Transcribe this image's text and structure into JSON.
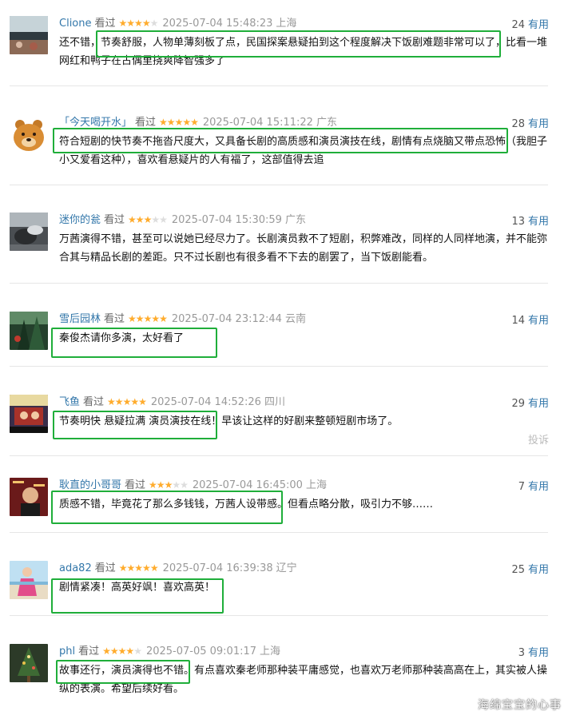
{
  "watched_label": "看过",
  "useful_label": "有用",
  "report_label": "投诉",
  "watermark": "海绵宝宝的心事",
  "comments": [
    {
      "user": "Clione",
      "stars": 4,
      "time": "2025-07-04 15:48:23",
      "location": "上海",
      "useful": "24",
      "text": "还不错，节奏舒服，人物单薄刻板了点，民国探案悬疑拍到这个程度解决下饭剧难题非常可以了，比看一堆网红和鸭子在古偶里挠爽降智强多了",
      "highlight": "节奏舒服，人物单薄刻板了点，民国探案悬疑拍到这个程度解决下饭剧难题非常可以了，"
    },
    {
      "user": "「今天喝开水」",
      "stars": 5,
      "time": "2025-07-04 15:11:22",
      "location": "广东",
      "useful": "28",
      "text": "符合短剧的快节奏不拖沓尺度大，又具备长剧的高质感和演员演技在线，剧情有点烧脑又带点恐怖（我胆子小又爱看这种），喜欢看悬疑片的人有福了，这部值得去追",
      "highlight": "符合短剧的快节奏不拖沓尺度大，又具备长剧的高质感和演员演技在线，剧情有点烧脑又带点恐怖"
    },
    {
      "user": "迷你的瓮",
      "stars": 3,
      "time": "2025-07-04 15:30:59",
      "location": "广东",
      "useful": "13",
      "text": "万茜演得不错，甚至可以说她已经尽力了。长剧演员救不了短剧，积弊难改，同样的人同样地演，并不能弥合其与精品长剧的差距。只不过长剧也有很多看不下去的剧罢了，当下饭剧能看。",
      "highlight": ""
    },
    {
      "user": "雪后园林",
      "stars": 5,
      "time": "2025-07-04 23:12:44",
      "location": "云南",
      "useful": "14",
      "text": "秦俊杰请你多演，太好看了",
      "highlight": "秦俊杰请你多演，太好看了"
    },
    {
      "user": "飞鱼",
      "stars": 5,
      "time": "2025-07-04 14:52:26",
      "location": "四川",
      "useful": "29",
      "text": "节奏明快 悬疑拉满 演员演技在线！早该让这样的好剧来整顿短剧市场了。",
      "highlight": "节奏明快 悬疑拉满 演员演技在线！"
    },
    {
      "user": "耿直的小哥哥",
      "stars": 3,
      "time": "2025-07-04 16:45:00",
      "location": "上海",
      "useful": "7",
      "text": "质感不错，毕竟花了那么多钱钱，万茜人设带感。但看点略分散，吸引力不够……",
      "highlight": "质感不错，毕竟花了那么多钱钱，万茜人设带感。"
    },
    {
      "user": "ada82",
      "stars": 5,
      "time": "2025-07-04 16:39:38",
      "location": "辽宁",
      "useful": "25",
      "text": "剧情紧凑！高英好飒！喜欢高英！",
      "highlight": "剧情紧凑！高英好飒！喜欢高英！"
    },
    {
      "user": "phl",
      "stars": 4,
      "time": "2025-07-05 09:01:17",
      "location": "上海",
      "useful": "3",
      "text": "故事还行，演员演得也不错。有点喜欢秦老师那种装平庸感觉，也喜欢万老师那种装高高在上，其实被人操纵的表演。希望后续好看。",
      "highlight": "故事还行，演员演得也不错。"
    }
  ]
}
